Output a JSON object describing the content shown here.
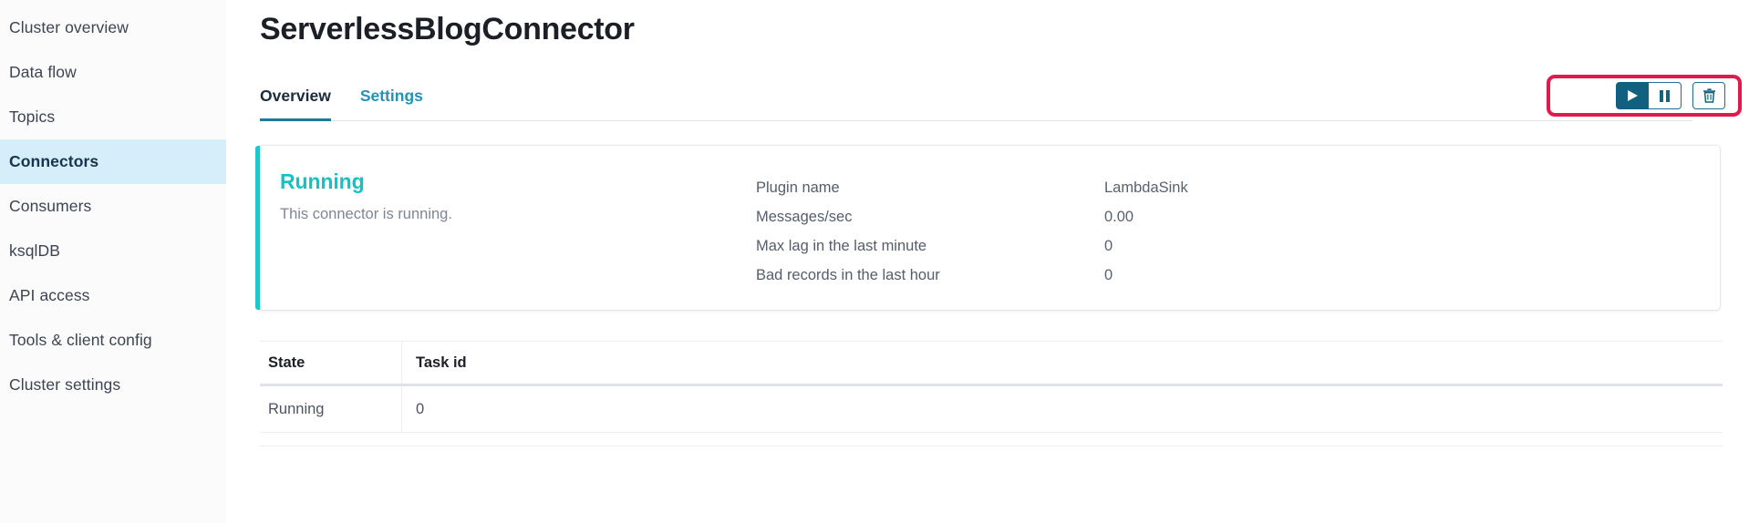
{
  "sidebar": {
    "items": [
      {
        "label": "Cluster overview",
        "active": false
      },
      {
        "label": "Data flow",
        "active": false
      },
      {
        "label": "Topics",
        "active": false
      },
      {
        "label": "Connectors",
        "active": true
      },
      {
        "label": "Consumers",
        "active": false
      },
      {
        "label": "ksqlDB",
        "active": false
      },
      {
        "label": "API access",
        "active": false
      },
      {
        "label": "Tools & client config",
        "active": false
      },
      {
        "label": "Cluster settings",
        "active": false
      }
    ]
  },
  "header": {
    "title": "ServerlessBlogConnector"
  },
  "tabs": [
    {
      "label": "Overview",
      "active": true
    },
    {
      "label": "Settings",
      "active": false
    }
  ],
  "actions": {
    "highlight_color": "#e01b4c",
    "buttons": [
      {
        "name": "resume-button",
        "icon": "play-icon",
        "label": "Resume",
        "primary": true
      },
      {
        "name": "pause-button",
        "icon": "pause-icon",
        "label": "Pause",
        "primary": false
      },
      {
        "name": "delete-button",
        "icon": "trash-icon",
        "label": "Delete",
        "primary": false
      }
    ]
  },
  "status_card": {
    "accent_color": "#1ec8c8",
    "title": "Running",
    "description": "This connector is running.",
    "metrics": [
      {
        "label": "Plugin name",
        "value": "LambdaSink"
      },
      {
        "label": "Messages/sec",
        "value": "0.00"
      },
      {
        "label": "Max lag in the last minute",
        "value": "0"
      },
      {
        "label": "Bad records in the last hour",
        "value": "0"
      }
    ]
  },
  "tasks_table": {
    "columns": [
      "State",
      "Task id"
    ],
    "rows": [
      {
        "state": "Running",
        "task_id": "0"
      }
    ]
  }
}
